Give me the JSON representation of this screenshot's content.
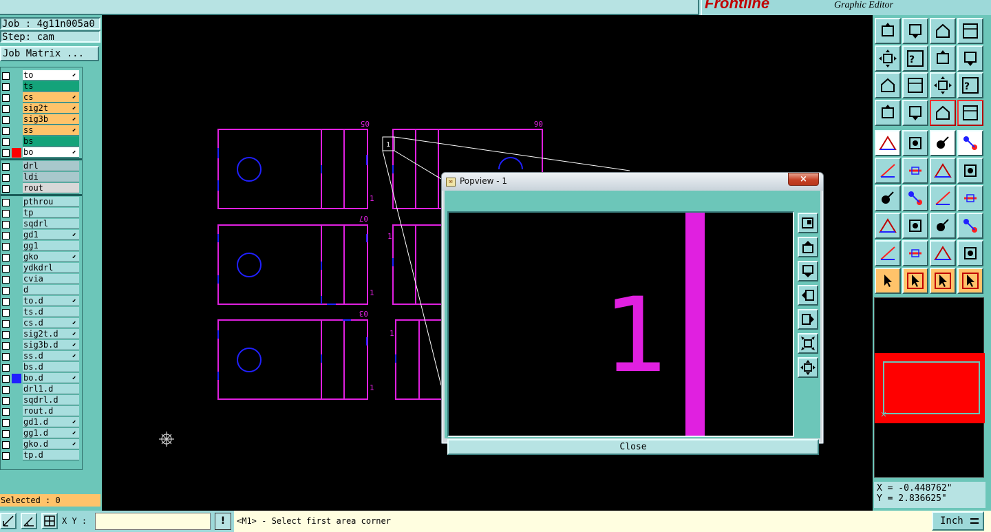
{
  "app": {
    "brand": "Frontline",
    "editor_title": "Graphic Editor"
  },
  "left_panel": {
    "job_label": "Job : 4g11n005a0",
    "step_label": "Step: cam",
    "job_matrix_button": "Job Matrix ...",
    "selected_label": "Selected : 0",
    "layer_groups": [
      [
        {
          "name": "to",
          "color": "#ffffff",
          "arrow": true
        },
        {
          "name": "ts",
          "color": "#14a37a",
          "arrow": false
        },
        {
          "name": "cs",
          "color": "#ffc36a",
          "arrow": true
        },
        {
          "name": "sig2t",
          "color": "#ffc36a",
          "arrow": true
        },
        {
          "name": "sig3b",
          "color": "#ffc36a",
          "arrow": true
        },
        {
          "name": "ss",
          "color": "#ffc36a",
          "arrow": true
        },
        {
          "name": "bs",
          "color": "#14a37a",
          "arrow": false
        },
        {
          "name": "bo",
          "color": "#ffffff",
          "arrow": true,
          "swatch": "#ff0000",
          "active": true
        }
      ],
      [
        {
          "name": "drl",
          "color": "#a8c8cc",
          "arrow": false
        },
        {
          "name": "ldi",
          "color": "#a8c8cc",
          "arrow": false
        },
        {
          "name": "rout",
          "color": "#d8d8d8",
          "arrow": false
        }
      ],
      [
        {
          "name": "pthrou",
          "color": "#a8dede",
          "arrow": false
        },
        {
          "name": "tp",
          "color": "#a8dede",
          "arrow": false
        },
        {
          "name": "sqdrl",
          "color": "#a8dede",
          "arrow": false
        },
        {
          "name": "gd1",
          "color": "#a8dede",
          "arrow": true
        },
        {
          "name": "gg1",
          "color": "#a8dede",
          "arrow": false
        },
        {
          "name": "gko",
          "color": "#a8dede",
          "arrow": true
        },
        {
          "name": "ydkdrl",
          "color": "#a8dede",
          "arrow": false
        },
        {
          "name": "cvia",
          "color": "#a8dede",
          "arrow": false
        },
        {
          "name": "d",
          "color": "#a8dede",
          "arrow": false
        },
        {
          "name": "to.d",
          "color": "#a8dede",
          "arrow": true
        },
        {
          "name": "ts.d",
          "color": "#a8dede",
          "arrow": false
        },
        {
          "name": "cs.d",
          "color": "#a8dede",
          "arrow": true
        },
        {
          "name": "sig2t.d",
          "color": "#a8dede",
          "arrow": true
        },
        {
          "name": "sig3b.d",
          "color": "#a8dede",
          "arrow": true
        },
        {
          "name": "ss.d",
          "color": "#a8dede",
          "arrow": true
        },
        {
          "name": "bs.d",
          "color": "#a8dede",
          "arrow": false
        },
        {
          "name": "bo.d",
          "color": "#a8dede",
          "arrow": true,
          "swatch": "#2020ff"
        },
        {
          "name": "drl1.d",
          "color": "#a8dede",
          "arrow": false
        },
        {
          "name": "sqdrl.d",
          "color": "#a8dede",
          "arrow": false
        },
        {
          "name": "rout.d",
          "color": "#a8dede",
          "arrow": false
        },
        {
          "name": "gd1.d",
          "color": "#a8dede",
          "arrow": true
        },
        {
          "name": "gg1.d",
          "color": "#a8dede",
          "arrow": true
        },
        {
          "name": "gko.d",
          "color": "#a8dede",
          "arrow": true
        },
        {
          "name": "tp.d",
          "color": "#a8dede",
          "arrow": false
        }
      ]
    ]
  },
  "canvas": {
    "board_labels": [
      "05",
      "06",
      "07",
      "03"
    ],
    "side_label": "1",
    "colors": {
      "outline": "#e020e0",
      "pad": "#2020ff",
      "zoom_line": "#ffffff"
    }
  },
  "popview": {
    "title": "Popview - 1",
    "close_x": "×",
    "close_button": "Close",
    "big_label": "1",
    "tool_icons": [
      "zoom-window-icon",
      "pan-up-icon",
      "pan-down-icon",
      "pan-left-icon",
      "pan-right-icon",
      "zoom-in-icon",
      "zoom-out-icon"
    ]
  },
  "right_panel": {
    "coord_x": "X = -0.448762\"",
    "coord_y": "Y = 2.836625\""
  },
  "bottom": {
    "xy_label": "X Y :",
    "xy_value": "",
    "warn_label": "!",
    "prompt": "<M1> - Select first area corner",
    "unit": "Inch"
  }
}
